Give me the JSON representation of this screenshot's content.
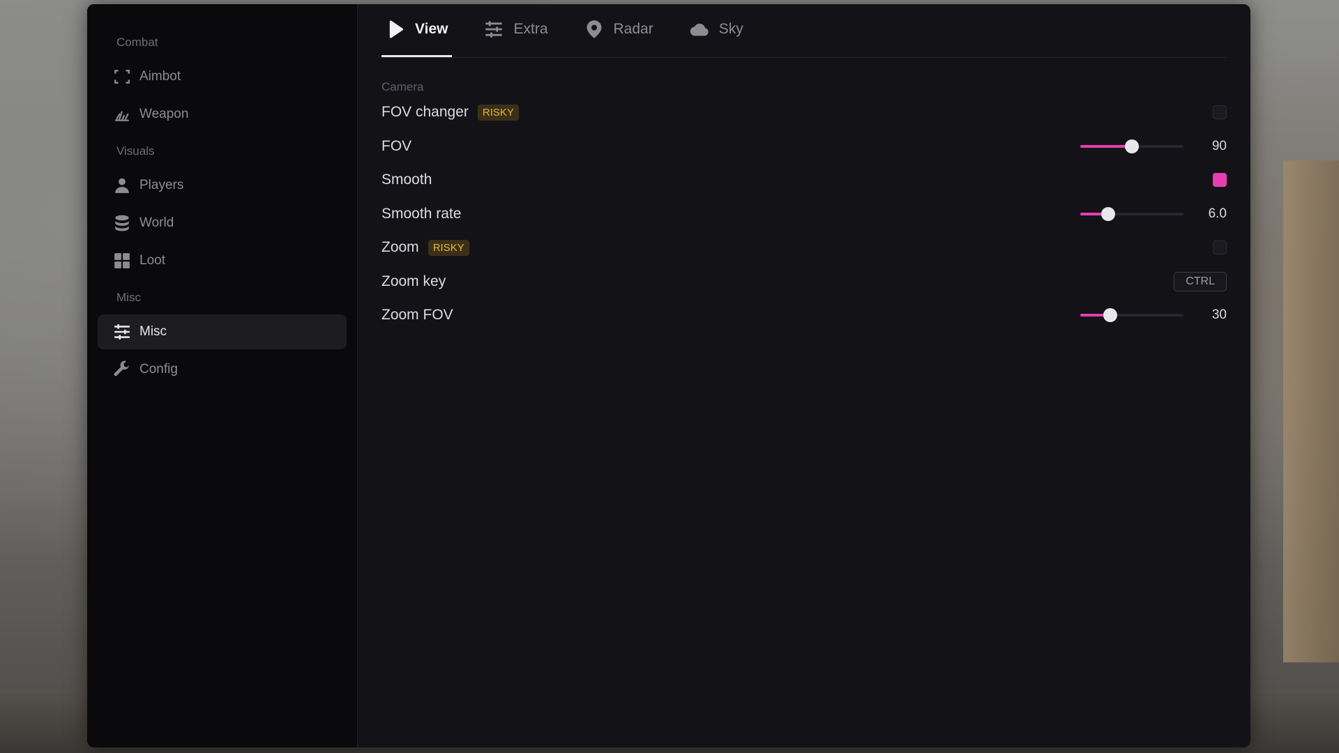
{
  "sidebar": {
    "groups": [
      {
        "label": "Combat",
        "items": [
          {
            "label": "Aimbot",
            "icon": "crosshair-frame-icon"
          },
          {
            "label": "Weapon",
            "icon": "weapon-icon"
          }
        ]
      },
      {
        "label": "Visuals",
        "items": [
          {
            "label": "Players",
            "icon": "user-icon"
          },
          {
            "label": "World",
            "icon": "database-icon"
          },
          {
            "label": "Loot",
            "icon": "grid-icon"
          }
        ]
      },
      {
        "label": "Misc",
        "items": [
          {
            "label": "Misc",
            "icon": "sliders-icon",
            "active": true
          },
          {
            "label": "Config",
            "icon": "wrench-icon"
          }
        ]
      }
    ]
  },
  "tabs": [
    {
      "label": "View",
      "icon": "play-icon",
      "active": true
    },
    {
      "label": "Extra",
      "icon": "sliders-icon"
    },
    {
      "label": "Radar",
      "icon": "map-pin-icon"
    },
    {
      "label": "Sky",
      "icon": "cloud-icon"
    }
  ],
  "section": {
    "label": "Camera",
    "rows": [
      {
        "label": "FOV changer",
        "badge": "RISKY",
        "control": "checkbox",
        "checked": false
      },
      {
        "label": "FOV",
        "control": "slider",
        "fraction": 0.5,
        "value": "90"
      },
      {
        "label": "Smooth",
        "control": "checkbox",
        "checked": true
      },
      {
        "label": "Smooth rate",
        "control": "slider",
        "fraction": 0.27,
        "value": "6.0"
      },
      {
        "label": "Zoom",
        "badge": "RISKY",
        "control": "checkbox",
        "checked": false
      },
      {
        "label": "Zoom key",
        "control": "keybind",
        "value": "CTRL"
      },
      {
        "label": "Zoom FOV",
        "control": "slider",
        "fraction": 0.29,
        "value": "30"
      }
    ]
  },
  "colors": {
    "accent": "#e83cb1",
    "badge_text": "#e5b53a",
    "badge_bg": "#3b3017"
  }
}
